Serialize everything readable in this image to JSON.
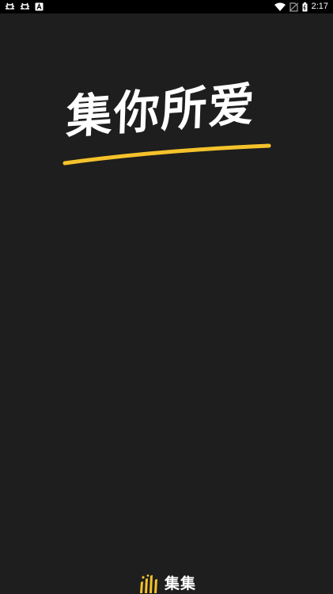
{
  "status_bar": {
    "time": "2:17",
    "left_icons": [
      "debug-bug-icon",
      "debug-bug-icon",
      "a-box-icon"
    ],
    "right_icons": [
      "wifi-icon",
      "no-sim-icon",
      "battery-icon"
    ]
  },
  "splash": {
    "slogan": "集你所爱",
    "underline_color": "#f5c22b"
  },
  "brand": {
    "name": "集集",
    "logo_icon": "brand-bars-logo-icon",
    "accent_color": "#f5c22b"
  },
  "colors": {
    "background": "#1e1e1e",
    "status_bar": "#000000",
    "text": "#ffffff"
  }
}
